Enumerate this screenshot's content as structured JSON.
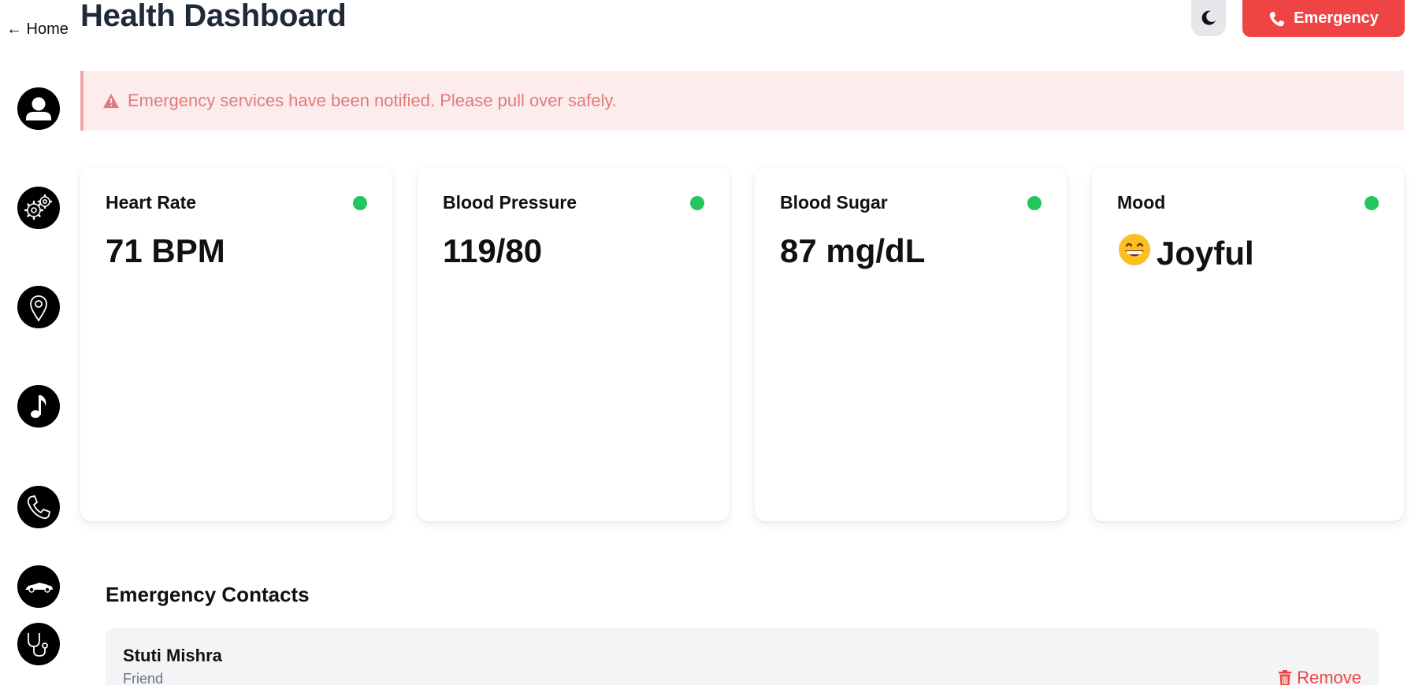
{
  "nav": {
    "home_label": "← Home",
    "icons": [
      "profile-icon",
      "settings-gears-icon",
      "location-pin-icon",
      "music-note-icon",
      "phone-icon",
      "car-icon",
      "stethoscope-icon"
    ]
  },
  "header": {
    "title": "Health Dashboard",
    "emergency_label": "Emergency"
  },
  "alert": {
    "message": "Emergency services have been notified. Please pull over safely.",
    "color": "#e07b7b"
  },
  "vitals": [
    {
      "label": "Heart Rate",
      "value": "71 BPM",
      "status": "ok"
    },
    {
      "label": "Blood Pressure",
      "value": "119/80",
      "status": "ok"
    },
    {
      "label": "Blood Sugar",
      "value": "87 mg/dL",
      "status": "ok"
    },
    {
      "label": "Mood",
      "value": "Joyful",
      "emoji": "😁",
      "status": "ok"
    }
  ],
  "contacts": {
    "title": "Emergency Contacts",
    "items": [
      {
        "name": "Stuti Mishra",
        "relation": "Friend",
        "remove_label": "Remove"
      }
    ]
  },
  "colors": {
    "accent_red": "#ef4444",
    "status_green": "#22c55e",
    "title": "#1f2937"
  }
}
